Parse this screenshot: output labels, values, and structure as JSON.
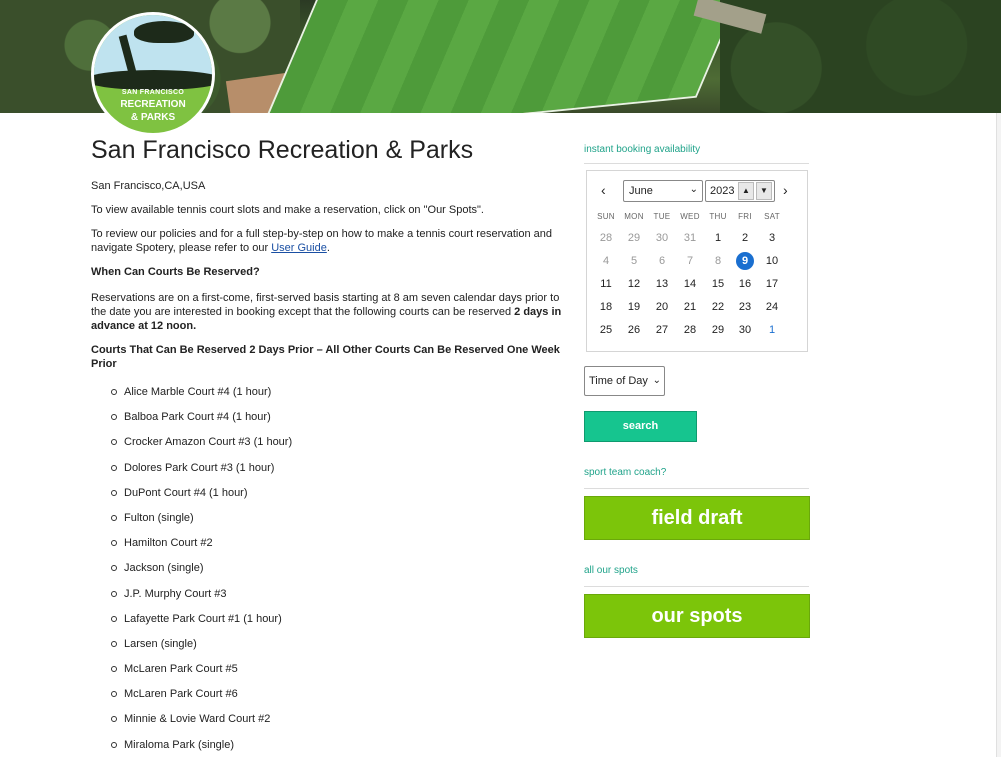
{
  "logo": {
    "line1": "SAN FRANCISCO",
    "line2": "RECREATION",
    "line3": "& PARKS"
  },
  "main": {
    "title": "San Francisco Recreation & Parks",
    "location": "San Francisco,CA,USA",
    "intro": "To view available tennis court slots and make a reservation, click on \"Our Spots\".",
    "policy_text": "To review our policies and for a full step-by-step on how to make a tennis court reservation and navigate Spotery, please refer to our ",
    "guide_link": "User Guide",
    "guide_after": ".",
    "when_heading": "When Can Courts Be Reserved?",
    "reservations_text": "Reservations are on a first-come, first-served basis starting at 8 am seven calendar days prior to the date you are interested in booking except that the following courts can be reserved ",
    "reservations_bold": "2 days in advance at 12 noon.",
    "courts_heading": "Courts That Can Be Reserved 2 Days Prior – All Other Courts Can Be Reserved One Week Prior",
    "courts": [
      "Alice Marble Court #4 (1 hour)",
      "Balboa Park Court #4 (1 hour)",
      "Crocker Amazon Court #3 (1 hour)",
      "Dolores Park Court #3 (1 hour)",
      "DuPont Court #4 (1 hour)",
      "Fulton (single)",
      "Hamilton Court #2",
      "Jackson (single)",
      "J.P. Murphy Court #3",
      "Lafayette Park Court #1 (1 hour)",
      "Larsen (single)",
      "McLaren Park Court #5",
      "McLaren Park Court #6",
      "Minnie & Lovie Ward Court #2",
      "Miraloma Park (single)"
    ]
  },
  "sidebar": {
    "instant_label": "instant booking availability",
    "calendar": {
      "prev": "‹",
      "next": "›",
      "month": "June",
      "year": "2023",
      "dows": [
        "SUN",
        "MON",
        "TUE",
        "WED",
        "THU",
        "FRI",
        "SAT"
      ],
      "weeks": [
        [
          "28",
          "29",
          "30",
          "31",
          "1",
          "2",
          "3"
        ],
        [
          "4",
          "5",
          "6",
          "7",
          "8",
          "9",
          "10"
        ],
        [
          "11",
          "12",
          "13",
          "14",
          "15",
          "16",
          "17"
        ],
        [
          "18",
          "19",
          "20",
          "21",
          "22",
          "23",
          "24"
        ],
        [
          "25",
          "26",
          "27",
          "28",
          "29",
          "30",
          "1"
        ]
      ],
      "selected": "9"
    },
    "time_of_day": "Time of Day",
    "search_label": "search",
    "coach_label": "sport team coach?",
    "field_draft_label": "field draft",
    "all_spots_label": "all our spots",
    "our_spots_label": "our spots"
  }
}
